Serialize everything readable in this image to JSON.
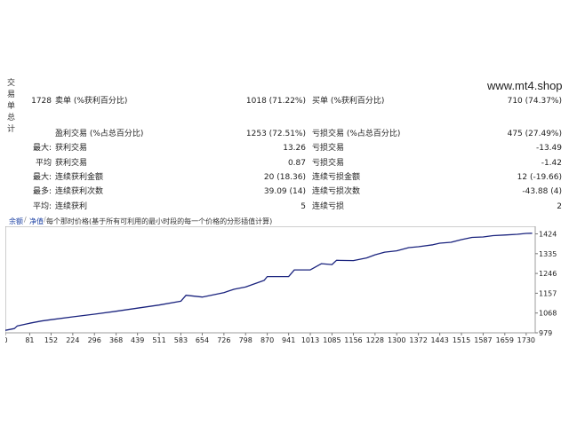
{
  "side_label": [
    "交",
    "易",
    "单",
    "总",
    "计"
  ],
  "watermark": "www.mt4.shop",
  "rows": [
    {
      "c1": "1728",
      "c2": "卖单 (%获利百分比)",
      "c3": "1018 (71.22%)",
      "c4": "买单 (%获利百分比)",
      "c5": "710 (74.37%)"
    },
    {
      "c1": "",
      "c2": "盈利交易 (%占总百分比)",
      "c3": "1253 (72.51%)",
      "c4": "亏损交易 (%占总百分比)",
      "c5": "475 (27.49%)"
    },
    {
      "c1": "最大:",
      "c2": "获利交易",
      "c3": "13.26",
      "c4": "亏损交易",
      "c5": "-13.49"
    },
    {
      "c1": "平均",
      "c2": "获利交易",
      "c3": "0.87",
      "c4": "亏损交易",
      "c5": "-1.42"
    },
    {
      "c1": "最大:",
      "c2": "连续获利金额",
      "c3": "20 (18.36)",
      "c4": "连续亏损金额",
      "c5": "12 (-19.66)"
    },
    {
      "c1": "最多:",
      "c2": "连续获利次数",
      "c3": "39.09 (14)",
      "c4": "连续亏损次数",
      "c5": "-43.88 (4)"
    },
    {
      "c1": "平均:",
      "c2": "连续获利",
      "c3": "5",
      "c4": "连续亏损",
      "c5": "2"
    }
  ],
  "toolbar": {
    "btn1": "余额",
    "btn2": "净值",
    "desc": "每个那时价格(基于所有可利用的最小时段的每一个价格的分形插值计算)"
  },
  "chart_data": {
    "type": "line",
    "title": "",
    "xlabel": "",
    "ylabel": "",
    "xlim": [
      0,
      1760
    ],
    "ylim": [
      979,
      1450
    ],
    "xticks": [
      0,
      81,
      152,
      224,
      296,
      368,
      439,
      511,
      583,
      654,
      726,
      798,
      870,
      941,
      1013,
      1085,
      1156,
      1228,
      1300,
      1372,
      1443,
      1515,
      1587,
      1659,
      1730
    ],
    "yticks": [
      1424,
      1335,
      1246,
      1157,
      1068,
      979
    ],
    "line_color": "#1a237e",
    "x": [
      0,
      30,
      40,
      81,
      120,
      152,
      224,
      296,
      368,
      439,
      511,
      583,
      600,
      654,
      726,
      760,
      798,
      860,
      870,
      941,
      960,
      1013,
      1050,
      1085,
      1100,
      1156,
      1200,
      1228,
      1260,
      1300,
      1340,
      1372,
      1420,
      1443,
      1480,
      1515,
      1550,
      1587,
      1620,
      1659,
      1700,
      1730,
      1750
    ],
    "y": [
      990,
      998,
      1010,
      1022,
      1032,
      1038,
      1051,
      1063,
      1076,
      1090,
      1104,
      1121,
      1148,
      1140,
      1160,
      1175,
      1185,
      1215,
      1232,
      1232,
      1262,
      1262,
      1290,
      1286,
      1305,
      1304,
      1316,
      1330,
      1342,
      1348,
      1362,
      1366,
      1375,
      1382,
      1386,
      1398,
      1408,
      1410,
      1416,
      1419,
      1422,
      1426,
      1427
    ]
  }
}
